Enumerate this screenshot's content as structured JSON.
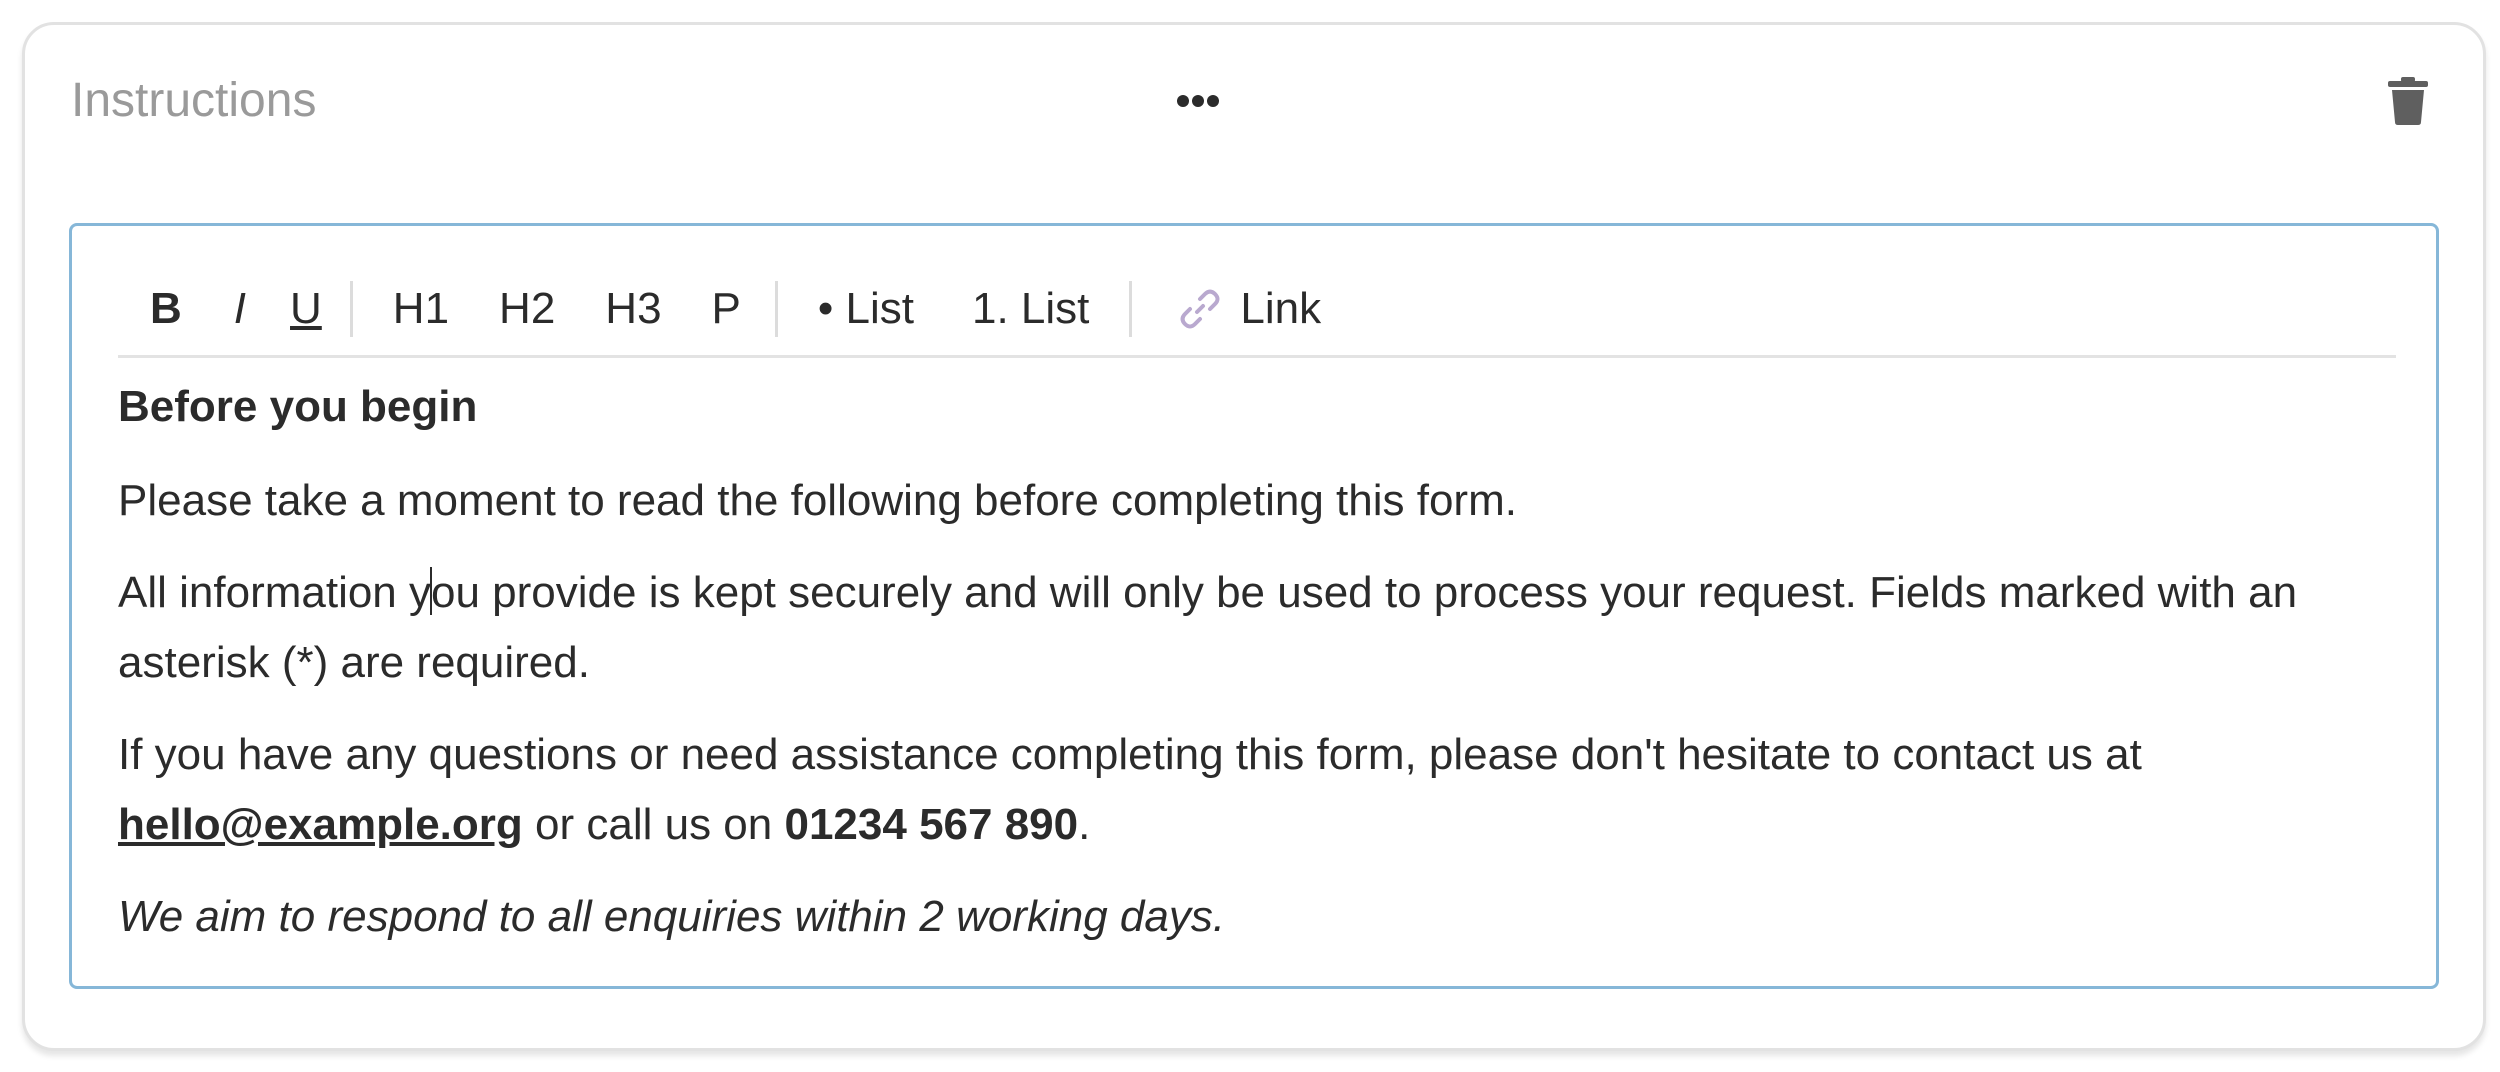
{
  "card": {
    "title": "Instructions",
    "icons": {
      "drag": "drag-handle-dots-icon",
      "delete": "trash-icon"
    }
  },
  "toolbar": {
    "bold": "B",
    "italic": "I",
    "underline": "U",
    "h1": "H1",
    "h2": "H2",
    "h3": "H3",
    "paragraph": "P",
    "bullet_list": "• List",
    "ordered_list": "1. List",
    "link": "Link",
    "link_icon": "link-chain-icon"
  },
  "content": {
    "heading": "Before you begin",
    "para1": "Please take a moment to read the following before completing this form.",
    "para2_before_caret": "All information y",
    "para2_after_caret": "ou provide is kept securely and will only be used to process your request. Fields marked with an asterisk (*) are required.",
    "para3_text": "If you have any questions or need assistance completing this form, please don't hesitate to contact us at ",
    "email": "hello@example.org",
    "para3_mid": " or call us on ",
    "phone": "01234 567 890",
    "para3_end": ".",
    "note": "We aim to respond to all enquiries within 2 working days."
  },
  "colors": {
    "editor_border": "#86b7d8",
    "card_border": "#e2e2e2",
    "title": "#9a9a9a",
    "text": "#2b2b2b",
    "link_icon": "#b9a9cf"
  }
}
